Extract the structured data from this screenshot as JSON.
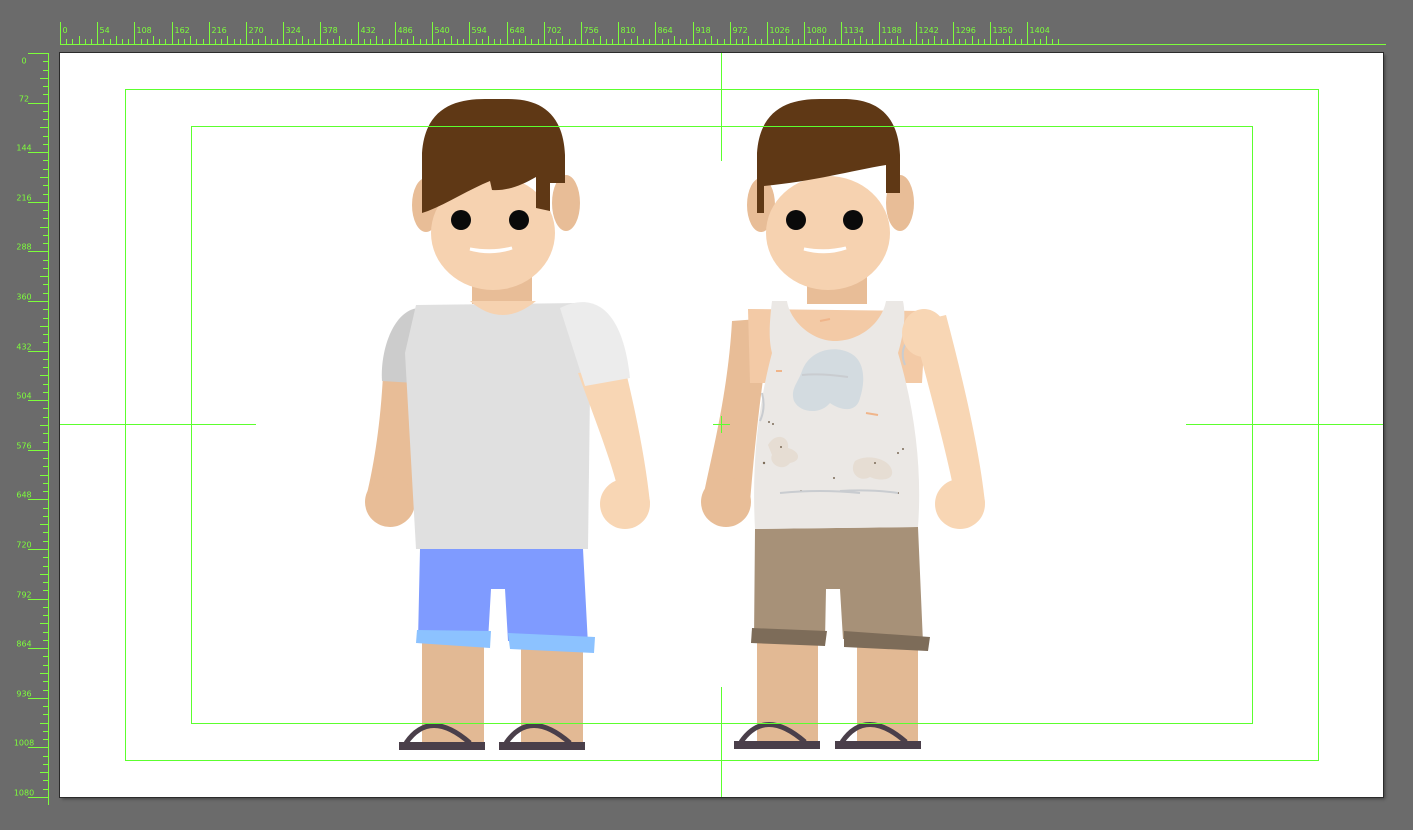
{
  "ruler": {
    "top_labels": [
      "0",
      "54",
      "108",
      "162",
      "216",
      "270",
      "324",
      "378",
      "432",
      "486",
      "540",
      "594",
      "648",
      "702",
      "756",
      "810",
      "864",
      "918",
      "972",
      "1026",
      "1080",
      "1134",
      "1188",
      "1242",
      "1296",
      "1350",
      "1404"
    ],
    "left_labels": [
      "0",
      "72",
      "144",
      "216",
      "288",
      "360",
      "432",
      "504",
      "576",
      "648",
      "720",
      "792",
      "864",
      "936",
      "1008",
      "1080"
    ]
  },
  "colors": {
    "workspace": "#6b6b6b",
    "ruler_ink": "#7dff3b",
    "guide": "#5cff2e",
    "canvas": "#ffffff",
    "hair": "#5f3815",
    "skin": "#f6d2b0",
    "skin_shade": "#e8bd97",
    "tshirt": "#e0e0e0",
    "sleeve": "#ececec",
    "sleeve_shade": "#cccccc",
    "shorts_blue": "#7f9bff",
    "cuff_blue": "#8cc2ff",
    "tank": "#ebe8e5",
    "shorts_khaki": "#a79178",
    "cuff_khaki": "#7d6c59",
    "sandal": "#4a3f4a"
  },
  "characters": [
    {
      "name": "clean-boy",
      "outfit": "t-shirt and blue shorts"
    },
    {
      "name": "dirty-boy",
      "outfit": "stained tank top and khaki shorts"
    }
  ]
}
